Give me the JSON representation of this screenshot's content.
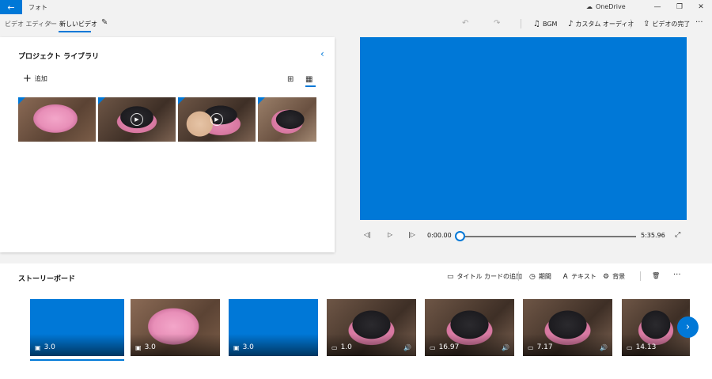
{
  "titlebar": {
    "app_title": "フォト",
    "onedrive": "OneDrive",
    "back_glyph": "←",
    "cloud_glyph": "☁",
    "min_glyph": "—",
    "restore_glyph": "❐",
    "close_glyph": "✕"
  },
  "toolbar": {
    "breadcrumb_parent": "ビデオ エディター",
    "breadcrumb_sep": "›",
    "breadcrumb_current": "新しいビデオ",
    "edit_glyph": "✎",
    "undo_glyph": "↶",
    "redo_glyph": "↷",
    "bgm_label": "BGM",
    "bgm_glyph": "♫",
    "custom_audio_label": "カスタム オーディオ",
    "custom_audio_glyph": "♪",
    "finish_label": "ビデオの完了",
    "finish_glyph": "⇪",
    "more_glyph": "···"
  },
  "library": {
    "title": "プロジェクト ライブラリ",
    "collapse_glyph": "‹",
    "add_label": "追加",
    "add_glyph": "+",
    "grid_glyph": "⊞",
    "list_glyph": "▦",
    "play_glyph": "▶"
  },
  "player": {
    "current_time": "0:00.00",
    "total_time": "5:35.96",
    "progress": 0,
    "prev_glyph": "◁|",
    "play_glyph": "▷",
    "next_glyph": "|▷",
    "fullscreen_glyph": "⤢"
  },
  "storyboard": {
    "title": "ストーリーボード",
    "add_title_card": "タイトル カードの追加",
    "title_card_glyph": "▭",
    "duration_label": "期間",
    "duration_glyph": "◷",
    "text_label": "テキスト",
    "text_glyph": "Ꭺ",
    "background_label": "背景",
    "background_glyph": "⚙",
    "delete_glyph": "🗑",
    "more_glyph": "···",
    "next_glyph": "›",
    "clips": [
      {
        "duration": "3.0",
        "type_glyph": "▣"
      },
      {
        "duration": "3.0",
        "type_glyph": "▣"
      },
      {
        "duration": "3.0",
        "type_glyph": "▣"
      },
      {
        "duration": "1.0",
        "type_glyph": "▭",
        "vol_glyph": "🔊"
      },
      {
        "duration": "16.97",
        "type_glyph": "▭",
        "vol_glyph": "🔊"
      },
      {
        "duration": "7.17",
        "type_glyph": "▭",
        "vol_glyph": "🔊"
      },
      {
        "duration": "14.13",
        "type_glyph": "▭"
      }
    ]
  },
  "colors": {
    "accent": "#0078d7"
  }
}
